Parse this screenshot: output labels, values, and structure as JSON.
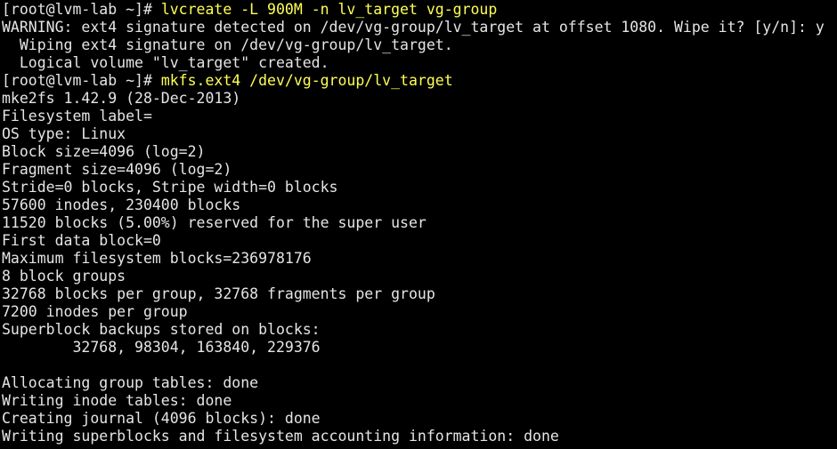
{
  "colors": {
    "background": "#000000",
    "text": "#e5e5e5",
    "command": "#ffff54"
  },
  "terminal": {
    "lines": [
      {
        "prompt": "[root@lvm-lab ~]# ",
        "command": "lvcreate -L 900M -n lv_target vg-group"
      },
      {
        "text": "WARNING: ext4 signature detected on /dev/vg-group/lv_target at offset 1080. Wipe it? [y/n]: y"
      },
      {
        "text": "  Wiping ext4 signature on /dev/vg-group/lv_target."
      },
      {
        "text": "  Logical volume \"lv_target\" created."
      },
      {
        "prompt": "[root@lvm-lab ~]# ",
        "command": "mkfs.ext4 /dev/vg-group/lv_target"
      },
      {
        "text": "mke2fs 1.42.9 (28-Dec-2013)"
      },
      {
        "text": "Filesystem label="
      },
      {
        "text": "OS type: Linux"
      },
      {
        "text": "Block size=4096 (log=2)"
      },
      {
        "text": "Fragment size=4096 (log=2)"
      },
      {
        "text": "Stride=0 blocks, Stripe width=0 blocks"
      },
      {
        "text": "57600 inodes, 230400 blocks"
      },
      {
        "text": "11520 blocks (5.00%) reserved for the super user"
      },
      {
        "text": "First data block=0"
      },
      {
        "text": "Maximum filesystem blocks=236978176"
      },
      {
        "text": "8 block groups"
      },
      {
        "text": "32768 blocks per group, 32768 fragments per group"
      },
      {
        "text": "7200 inodes per group"
      },
      {
        "text": "Superblock backups stored on blocks:"
      },
      {
        "text": "        32768, 98304, 163840, 229376"
      },
      {
        "text": ""
      },
      {
        "text": "Allocating group tables: done"
      },
      {
        "text": "Writing inode tables: done"
      },
      {
        "text": "Creating journal (4096 blocks): done"
      },
      {
        "text": "Writing superblocks and filesystem accounting information: done"
      }
    ]
  }
}
